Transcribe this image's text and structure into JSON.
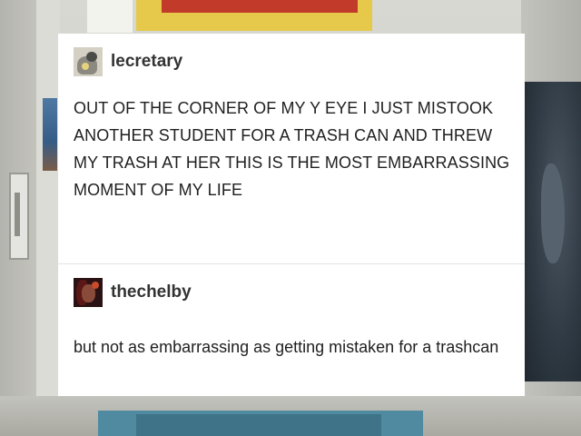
{
  "background": {
    "description_colors": {
      "accent_yellow": "#e6c94a",
      "accent_red": "#c23a2a",
      "floor_teal": "#4f8aa0"
    }
  },
  "posts": [
    {
      "username": "lecretary",
      "avatar_icon": "avatar-icon",
      "text": "OUT OF THE CORNER OF MY Y EYE I JUST MISTOOK ANOTHER STUDENT FOR A TRASH CAN AND THREW MY TRASH AT HER THIS IS THE MOST EMBARRASSING MOMENT OF MY LIFE"
    },
    {
      "username": "thechelby",
      "avatar_icon": "avatar-icon",
      "text": "but not as embarrassing as getting mistaken for a trashcan"
    }
  ]
}
